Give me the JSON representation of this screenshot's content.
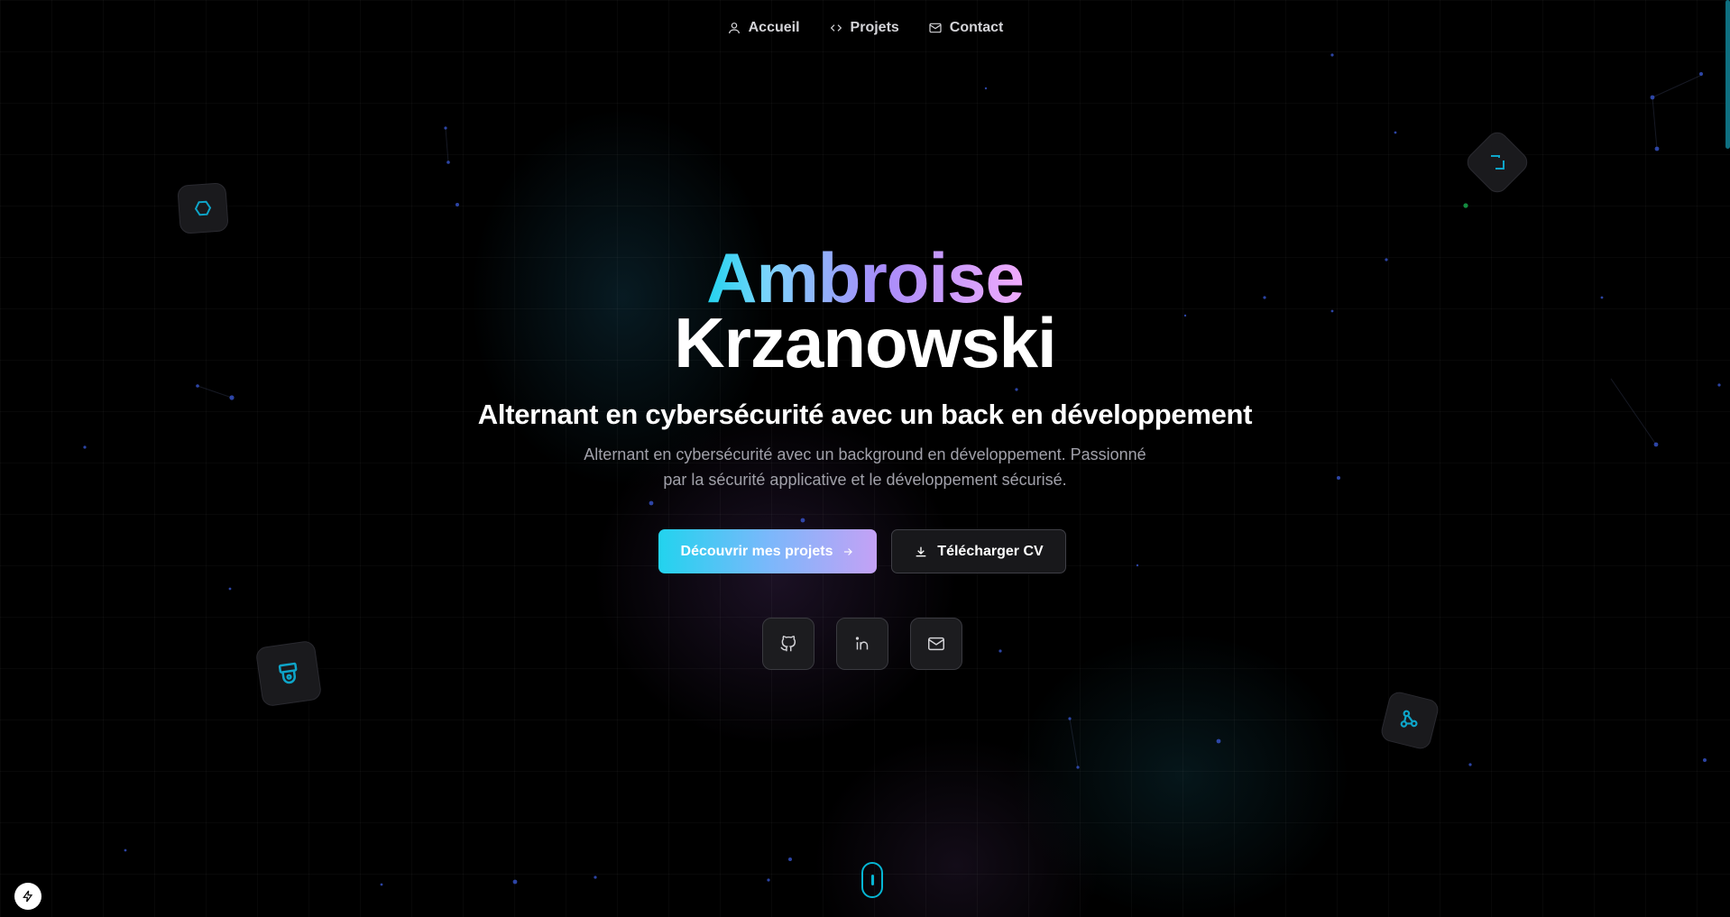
{
  "nav": {
    "items": [
      {
        "label": "Accueil",
        "icon": "user-icon"
      },
      {
        "label": "Projets",
        "icon": "code-icon"
      },
      {
        "label": "Contact",
        "icon": "mail-icon"
      }
    ]
  },
  "hero": {
    "first_name": "Ambroise",
    "last_name": "Krzanowski",
    "subtitle": "Alternant en cybersécurité avec un back en développement",
    "description_line1": "Alternant en cybersécurité avec un background en développement. Passionné",
    "description_line2": "par la sécurité applicative et le développement sécurisé."
  },
  "cta": {
    "primary_label": "Découvrir mes projets",
    "secondary_label": "Télécharger CV"
  },
  "social": [
    {
      "icon": "github-icon"
    },
    {
      "icon": "linkedin-icon"
    },
    {
      "icon": "mail-icon"
    }
  ],
  "floating_icons": [
    "hexagon-icon",
    "corner-bracket-icon",
    "pennant-icon",
    "network-icon"
  ],
  "colors": {
    "background": "#000000",
    "accent_cyan": "#22d3ee",
    "accent_violet": "#a78bfa",
    "accent_pink": "#f0abfc",
    "tile_icon": "#0ea5c9",
    "muted_text": "#a1a1aa"
  }
}
